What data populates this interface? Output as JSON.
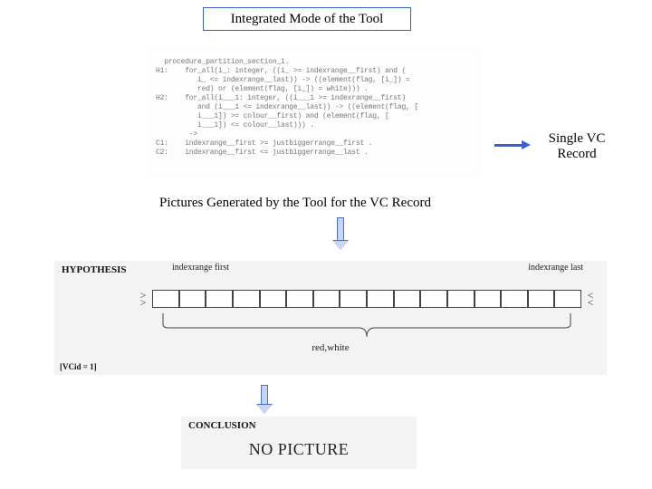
{
  "title": "Integrated Mode of the Tool",
  "code": "procedure_partition_section_1.\nH1:    for_all(i_: integer, ((i_ >= indexrange__first) and (\n          i_ <= indexrange__last)) -> ((element(flag, [i_]) =\n          red) or (element(flag, [i_]) = white))) .\nH2:    for_all(i___1: integer, ((i___1 >= indexrange__first)\n          and (i___1 <= indexrange__last)) -> ((element(flag, [\n          i___1]) >= colour__first) and (element(flag, [\n          i___1]) <= colour__last))) .\n        ->\nC1:    indexrange__first >= justbiggerrange__first .\nC2:    indexrange__first <= justbiggerrange__last .",
  "single_vc": {
    "line1": "Single VC",
    "line2": "Record"
  },
  "section_label": "Pictures Generated by the Tool for the VC Record",
  "hypothesis": {
    "label": "HYPOTHESIS",
    "axis_left": "indexrange   first",
    "axis_right": "indexrange   last",
    "cell_count": 16,
    "brace_label": "red,white",
    "vcid": "[VCid = 1]"
  },
  "conclusion": {
    "label": "CONCLUSION",
    "message": "NO PICTURE"
  }
}
